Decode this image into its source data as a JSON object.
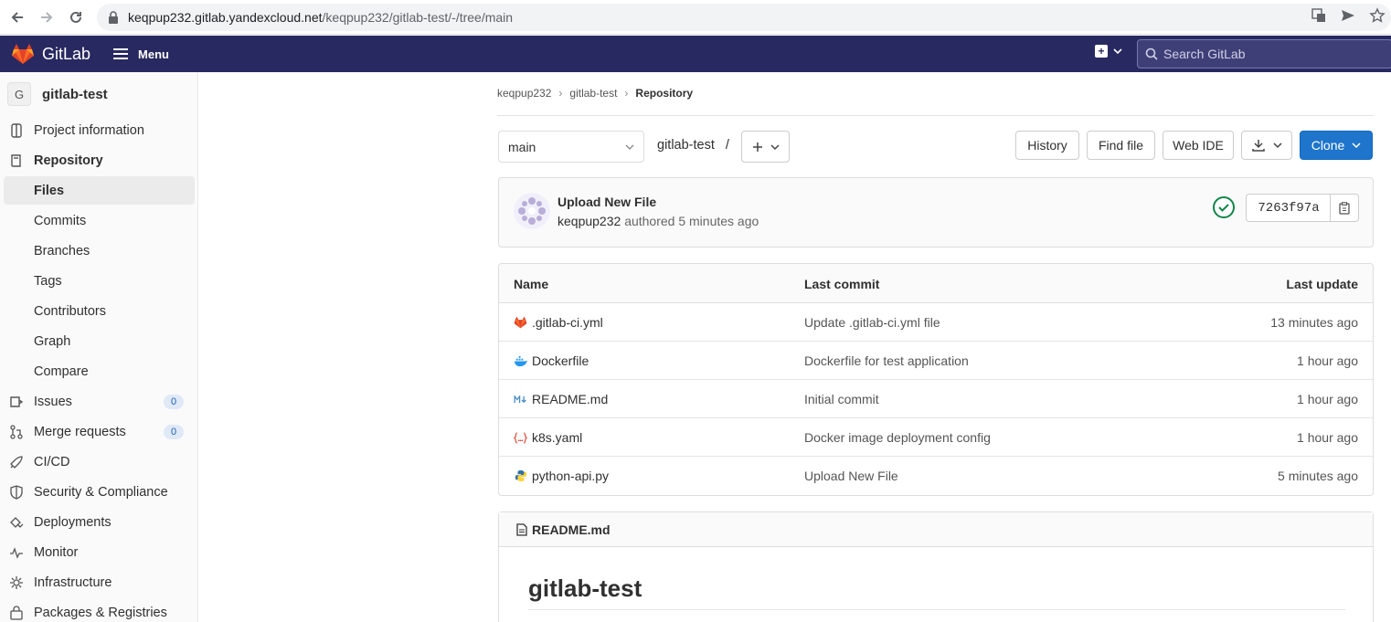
{
  "browser": {
    "host": "keqpup232.gitlab.yandexcloud.net",
    "path": "/keqpup232/gitlab-test/-/tree/main"
  },
  "header": {
    "brand": "GitLab",
    "menu_label": "Menu",
    "search_placeholder": "Search GitLab",
    "colors": {
      "bg": "#292961"
    }
  },
  "sidebar": {
    "project_initial": "G",
    "project_name": "gitlab-test",
    "items": [
      {
        "label": "Project information",
        "icon": "info-icon"
      },
      {
        "label": "Repository",
        "icon": "book-icon"
      },
      {
        "label": "Files"
      },
      {
        "label": "Commits"
      },
      {
        "label": "Branches"
      },
      {
        "label": "Tags"
      },
      {
        "label": "Contributors"
      },
      {
        "label": "Graph"
      },
      {
        "label": "Compare"
      },
      {
        "label": "Issues",
        "icon": "issues-icon",
        "badge": "0"
      },
      {
        "label": "Merge requests",
        "icon": "merge-request-icon",
        "badge": "0"
      },
      {
        "label": "CI/CD",
        "icon": "rocket-icon"
      },
      {
        "label": "Security & Compliance",
        "icon": "shield-icon"
      },
      {
        "label": "Deployments",
        "icon": "deployments-icon"
      },
      {
        "label": "Monitor",
        "icon": "monitor-icon"
      },
      {
        "label": "Infrastructure",
        "icon": "cloud-gear-icon"
      },
      {
        "label": "Packages & Registries",
        "icon": "package-icon"
      }
    ]
  },
  "breadcrumb": [
    "keqpup232",
    "gitlab-test",
    "Repository"
  ],
  "toolbar": {
    "branch": "main",
    "path": "gitlab-test",
    "path_sep": "/",
    "history": "History",
    "find_file": "Find file",
    "web_ide": "Web IDE",
    "clone": "Clone"
  },
  "commit": {
    "title": "Upload New File",
    "author": "keqpup232",
    "authored": "authored 5 minutes ago",
    "sha": "7263f97a",
    "status_color": "#108548"
  },
  "tree": {
    "headers": {
      "name": "Name",
      "commit": "Last commit",
      "update": "Last update"
    },
    "rows": [
      {
        "name": ".gitlab-ci.yml",
        "icon": "gitlab-icon",
        "commit": "Update .gitlab-ci.yml file",
        "update": "13 minutes ago"
      },
      {
        "name": "Dockerfile",
        "icon": "docker-icon",
        "commit": "Dockerfile for test application",
        "update": "1 hour ago"
      },
      {
        "name": "README.md",
        "icon": "markdown-icon",
        "commit": "Initial commit",
        "update": "1 hour ago"
      },
      {
        "name": "k8s.yaml",
        "icon": "yaml-icon",
        "commit": "Docker image deployment config",
        "update": "1 hour ago"
      },
      {
        "name": "python-api.py",
        "icon": "python-icon",
        "commit": "Upload New File",
        "update": "5 minutes ago"
      }
    ]
  },
  "readme": {
    "filename": "README.md",
    "heading": "gitlab-test"
  }
}
